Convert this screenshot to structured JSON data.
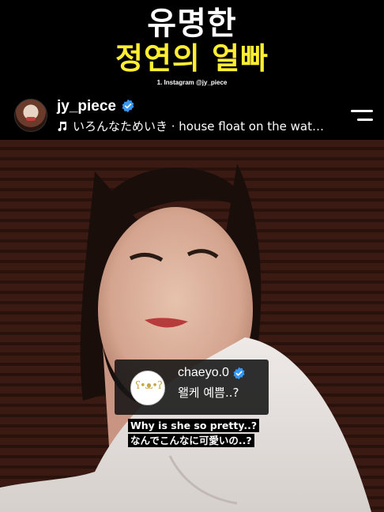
{
  "banner": {
    "title_line1": "유명한",
    "title_line2": "정연의 얼빠",
    "source": "1. Instagram @jy_piece",
    "title_line2_color": "#ffee32"
  },
  "profile": {
    "username": "jy_piece",
    "verified_icon": "verified-badge-icon",
    "song": "いろんなためいき · house float on the wat…",
    "menu_icon": "menu-icon"
  },
  "comment": {
    "username": "chaeyo.0",
    "avatar_text": "ʕ•ᴥ•ʔ",
    "text": "왤케 예쁨..?",
    "verified_color": "#3897f0"
  },
  "subtitles": {
    "english": "Why is she so pretty..?",
    "japanese": "なんでこんなに可愛いの..?"
  }
}
